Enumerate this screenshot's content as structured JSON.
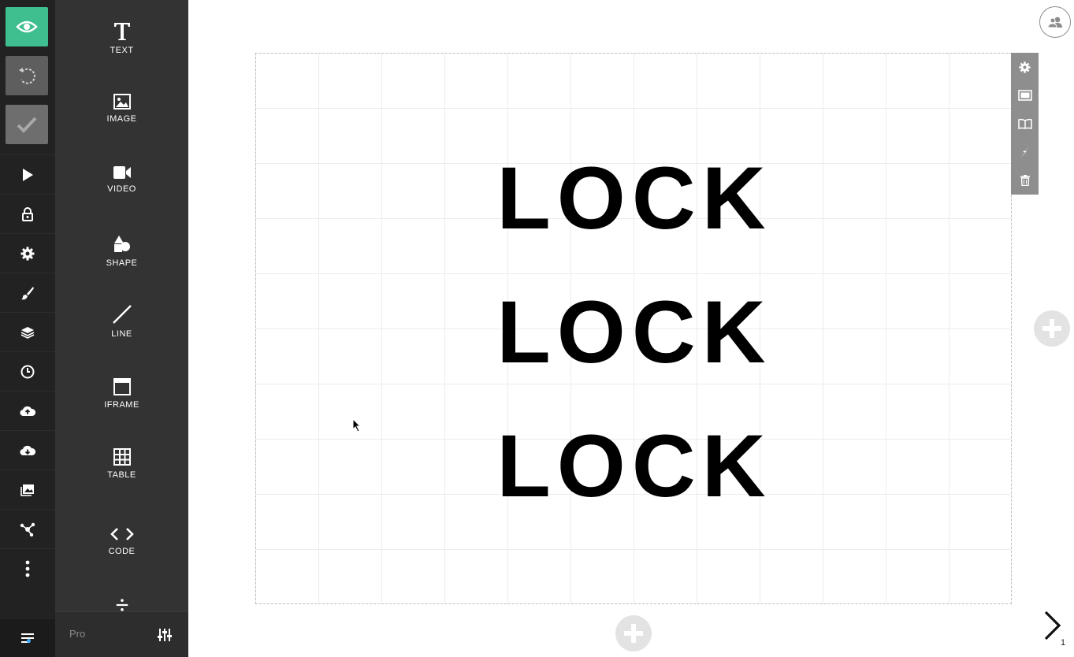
{
  "rail": {
    "top_buttons": [
      {
        "icon": "eye-icon",
        "color": "#3fbf8f"
      },
      {
        "icon": "undo-icon",
        "color": "#5e5e5e"
      },
      {
        "icon": "check-icon",
        "color": "#6e6e6e"
      }
    ],
    "items": [
      "play-icon",
      "lock-icon",
      "gear-icon",
      "brush-icon",
      "layers-icon",
      "clock-icon",
      "cloud-upload-icon",
      "cloud-download-icon",
      "media-icon",
      "share-icon",
      "more-icon"
    ],
    "bottom": "menu-icon"
  },
  "palette": {
    "items": [
      {
        "label": "TEXT",
        "icon": "text-icon"
      },
      {
        "label": "IMAGE",
        "icon": "image-icon"
      },
      {
        "label": "VIDEO",
        "icon": "video-icon"
      },
      {
        "label": "SHAPE",
        "icon": "shape-icon"
      },
      {
        "label": "LINE",
        "icon": "line-icon"
      },
      {
        "label": "IFRAME",
        "icon": "iframe-icon"
      },
      {
        "label": "TABLE",
        "icon": "table-icon"
      },
      {
        "label": "CODE",
        "icon": "code-icon"
      }
    ],
    "footer": {
      "pro_label": "Pro"
    }
  },
  "slide": {
    "lines": [
      "LOCK",
      "LOCK",
      "LOCK"
    ]
  },
  "side_toolbar": [
    "gear-icon",
    "background-icon",
    "notes-icon",
    "lightning-icon",
    "trash-icon"
  ],
  "navigation": {
    "page_number": "1"
  },
  "colors": {
    "accent": "#3fbf8f",
    "rail": "#222222",
    "palette": "#333333"
  }
}
